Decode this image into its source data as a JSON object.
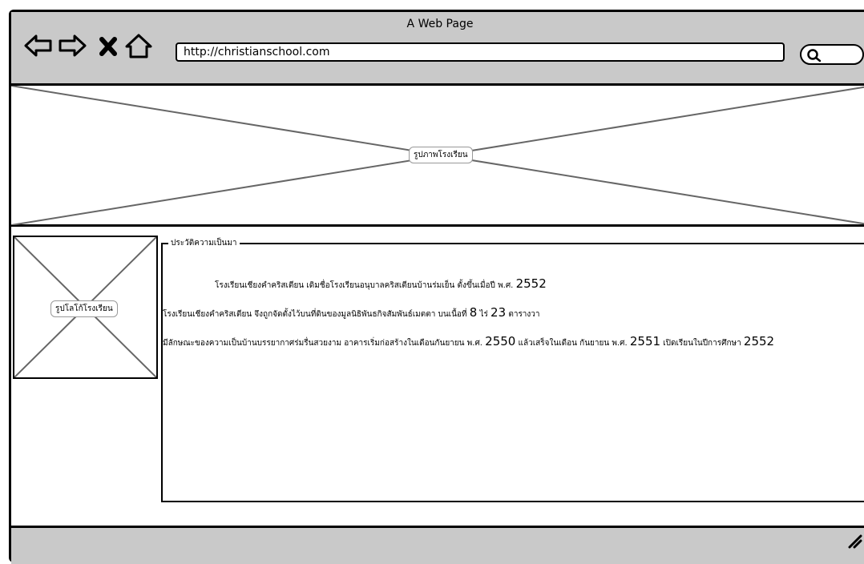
{
  "window": {
    "title": "A Web Page",
    "url": "http://christianschool.com"
  },
  "nav": {
    "back_icon": "arrow-left-icon",
    "forward_icon": "arrow-right-icon",
    "stop_icon": "close-icon",
    "home_icon": "home-icon",
    "search_icon": "search-icon"
  },
  "hero": {
    "label": "รูปภาพโรงเรียน"
  },
  "logo": {
    "label": "รูปโลโก้โรงเรียน"
  },
  "history": {
    "legend": "ประวัติความเป็นมา",
    "p1": {
      "text": "โรงเรียนเชียงคำคริสเตียน เดิมชื่อโรงเรียนอนุบาลคริสเตียนบ้านร่มเย็น ตั้งขึ้นเมื่อปี พ.ศ.",
      "year": "2552"
    },
    "p2": {
      "text_a": "โรงเรียนเชียงคำคริสเตียน จึงถูกจัดตั้งไว้บนที่ดินของมูลนิธิพันธกิจสัมพันธ์เมตตา บนเนื้อที่",
      "num_a": "8",
      "text_b": "ไร่",
      "num_b": "23",
      "text_c": "ตารางวา"
    },
    "p3": {
      "text_a": "มีลักษณะของความเป็นบ้านบรรยากาศร่มรื่นสวยงาม อาคารเริ่มก่อสร้างในเดือนกันยายน พ.ศ.",
      "year_a": "2550",
      "text_b": "แล้วเสร็จในเดือน กันยายน พ.ศ.",
      "year_b": "2551",
      "text_c": "เปิดเรียนในปีการศึกษา",
      "year_c": "2552"
    }
  },
  "colors": {
    "chrome": "#c9c9c9",
    "border": "#000000",
    "placeholder_line": "#666666"
  }
}
